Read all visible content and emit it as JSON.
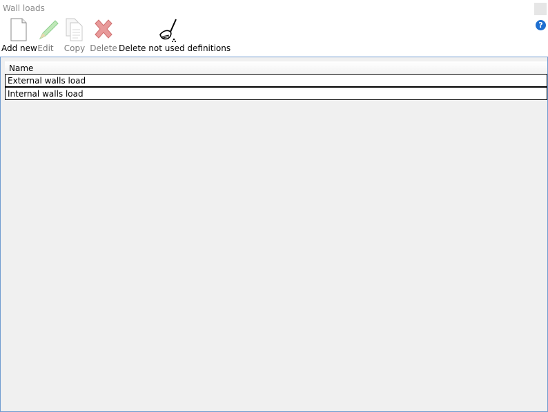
{
  "window": {
    "title": "Wall loads"
  },
  "toolbar": {
    "add_label": "Add new",
    "edit_label": "Edit",
    "copy_label": "Copy",
    "delete_label": "Delete",
    "cleanup_label": "Delete not used definitions"
  },
  "help": {
    "glyph": "?"
  },
  "grid": {
    "columns": [
      "Name"
    ],
    "rows": [
      {
        "name": "External walls load"
      },
      {
        "name": "Internal walls load"
      }
    ]
  },
  "colors": {
    "accent": "#1e6fd0",
    "delete_icon": "#e27a7a",
    "edit_icon": "#8fcf8f"
  }
}
